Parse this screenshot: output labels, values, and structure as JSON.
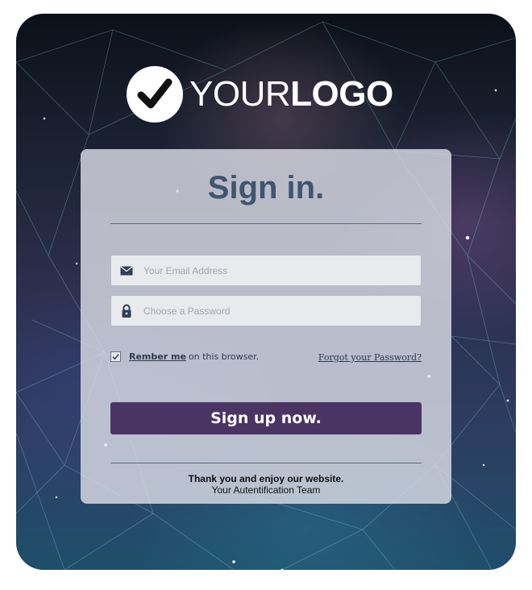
{
  "logo": {
    "text_light": "YOUR",
    "text_bold": "LOGO"
  },
  "signin": {
    "title": "Sign in.",
    "email_placeholder": "Your Email Address",
    "password_placeholder": "Choose a Password",
    "remember_bold": "Rember me",
    "remember_rest": "on this browser.",
    "remember_checked": true,
    "forgot_label": "Forgot your Password?",
    "submit_label": "Sign up now.",
    "footer_line1": "Thank you and enjoy our website.",
    "footer_line2": "Your Autentification Team"
  },
  "colors": {
    "button": "#4a3463",
    "title": "#3f5670"
  },
  "icons": {
    "email": "envelope-icon",
    "password": "lock-icon",
    "checkbox": "checkmark-icon",
    "logo": "checkmark-icon"
  }
}
